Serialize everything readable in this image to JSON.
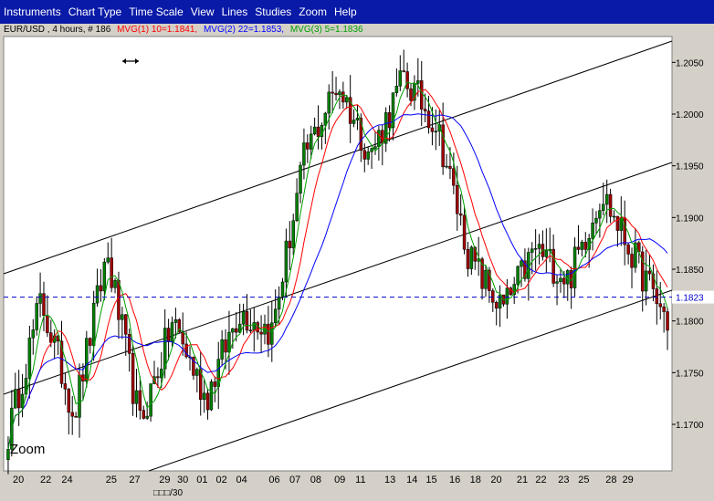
{
  "menu": {
    "items": [
      {
        "label": "Instruments",
        "name": "menu-instruments"
      },
      {
        "label": "Chart Type",
        "name": "menu-chart-type"
      },
      {
        "label": "Time Scale",
        "name": "menu-time-scale"
      },
      {
        "label": "View",
        "name": "menu-view"
      },
      {
        "label": "Lines",
        "name": "menu-lines"
      },
      {
        "label": "Studies",
        "name": "menu-studies"
      },
      {
        "label": "Zoom",
        "name": "menu-zoom"
      },
      {
        "label": "Help",
        "name": "menu-help"
      }
    ]
  },
  "header": {
    "symbol": "EUR/USD , 4 hours, # 186",
    "mvg1": "MVG(1) 10=1.1841,",
    "mvg2": "MVG(2) 22=1.1853,",
    "mvg3": "MVG(3) 5=1.1836"
  },
  "colors": {
    "menubar": "#0a1aa8",
    "candle_up": "#008000",
    "candle_down": "#a00000",
    "mvg1": "#ff0000",
    "mvg2": "#0000ff",
    "mvg3": "#00a000",
    "price_line": "#0000cc"
  },
  "zoom_label": "Zoom",
  "chart_data": {
    "type": "candlestick",
    "instrument": "EUR/USD",
    "timeframe": "4 hours",
    "bars": 186,
    "ylim": [
      1.1655,
      1.2075
    ],
    "y_ticks": [
      "1.2050",
      "1.2000",
      "1.1950",
      "1.1900",
      "1.1850",
      "1.1800",
      "1.1750",
      "1.1700"
    ],
    "x_ticks": [
      "20",
      "22",
      "24",
      "25",
      "27",
      "29",
      "30",
      "01",
      "02",
      "04",
      "06",
      "07",
      "08",
      "09",
      "11",
      "13",
      "14",
      "15",
      "16",
      "18",
      "20",
      "21",
      "22",
      "23",
      "25",
      "28",
      "29"
    ],
    "x_sub_label": "□□□/30",
    "current_price": "1.1823",
    "moving_averages": [
      {
        "name": "MVG(1)",
        "period": 10,
        "value": 1.1841,
        "color": "#ff0000"
      },
      {
        "name": "MVG(2)",
        "period": 22,
        "value": 1.1853,
        "color": "#0000ff"
      },
      {
        "name": "MVG(3)",
        "period": 5,
        "value": 1.1836,
        "color": "#00a000"
      }
    ],
    "key_points": [
      {
        "x": "20",
        "close": 1.169
      },
      {
        "x": "23",
        "close": 1.182
      },
      {
        "x": "27",
        "close": 1.171
      },
      {
        "x": "29",
        "close": 1.1865
      },
      {
        "x": "03",
        "close": 1.17
      },
      {
        "x": "06",
        "close": 1.18
      },
      {
        "x": "08",
        "close": 1.1725
      },
      {
        "x": "09",
        "close": 1.181
      },
      {
        "x": "11",
        "close": 1.179
      },
      {
        "x": "12",
        "close": 1.196
      },
      {
        "x": "14",
        "close": 1.203
      },
      {
        "x": "15",
        "close": 1.196
      },
      {
        "x": "18",
        "close": 1.2035
      },
      {
        "x": "20",
        "close": 1.199
      },
      {
        "x": "21",
        "close": 1.186
      },
      {
        "x": "22",
        "close": 1.181
      },
      {
        "x": "23",
        "close": 1.187
      },
      {
        "x": "25",
        "close": 1.184
      },
      {
        "x": "28",
        "close": 1.1925
      },
      {
        "x": "29",
        "close": 1.186
      },
      {
        "x": "29",
        "close": 1.18
      }
    ]
  }
}
